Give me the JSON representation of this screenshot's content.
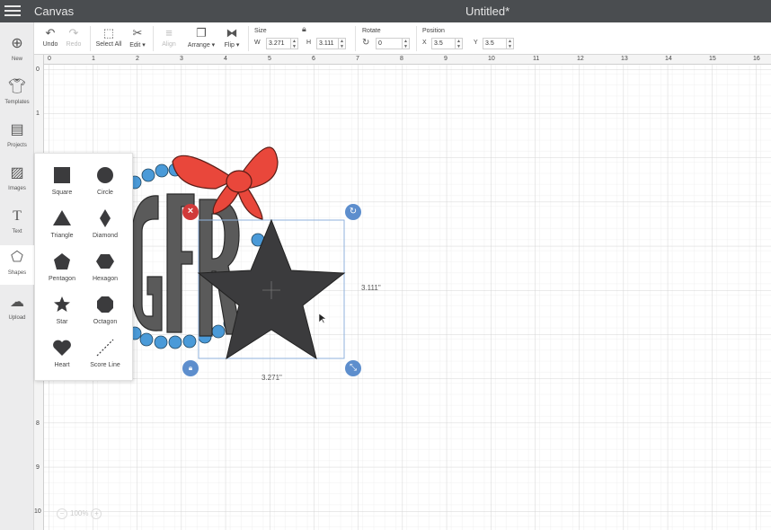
{
  "app": {
    "title": "Canvas",
    "document_title": "Untitled*"
  },
  "toolbar": {
    "undo": "Undo",
    "redo": "Redo",
    "select_all": "Select All",
    "edit": "Edit",
    "align": "Align",
    "arrange": "Arrange",
    "flip": "Flip",
    "size": {
      "label": "Size",
      "w_label": "W",
      "w_value": "3.271",
      "h_label": "H",
      "h_value": "3.111"
    },
    "rotate": {
      "label": "Rotate",
      "value": "0"
    },
    "position": {
      "label": "Position",
      "x_label": "X",
      "x_value": "3.5",
      "y_label": "Y",
      "y_value": "3.5"
    }
  },
  "sidebar": {
    "items": [
      {
        "label": "New",
        "icon": "plus-circle-icon"
      },
      {
        "label": "Templates",
        "icon": "tshirt-icon"
      },
      {
        "label": "Projects",
        "icon": "book-icon"
      },
      {
        "label": "Images",
        "icon": "image-icon"
      },
      {
        "label": "Text",
        "icon": "text-icon"
      },
      {
        "label": "Shapes",
        "icon": "shapes-icon"
      },
      {
        "label": "Upload",
        "icon": "cloud-upload-icon"
      }
    ]
  },
  "shapes_panel": {
    "items": [
      {
        "label": "Square"
      },
      {
        "label": "Circle"
      },
      {
        "label": "Triangle"
      },
      {
        "label": "Diamond"
      },
      {
        "label": "Pentagon"
      },
      {
        "label": "Hexagon"
      },
      {
        "label": "Star"
      },
      {
        "label": "Octagon"
      },
      {
        "label": "Heart"
      },
      {
        "label": "Score Line"
      }
    ]
  },
  "ruler": {
    "top": [
      "0",
      "1",
      "2",
      "3",
      "4",
      "5",
      "6",
      "7",
      "8",
      "9",
      "10",
      "11",
      "12",
      "13",
      "14",
      "15",
      "16"
    ],
    "left": [
      "0",
      "1",
      "8",
      "9",
      "10"
    ]
  },
  "selection": {
    "width_label": "3.271\"",
    "height_label": "3.111\""
  },
  "monogram": {
    "letters": "GFR"
  },
  "zoom": {
    "value": "100%",
    "minus": "−",
    "plus": "+"
  },
  "colors": {
    "topbar": "#4a4d50",
    "star": "#3b3b3d",
    "bow": "#e9473b",
    "dots": "#4a9ad8",
    "selection": "#5d8ecd",
    "delete": "#d03a3a"
  }
}
